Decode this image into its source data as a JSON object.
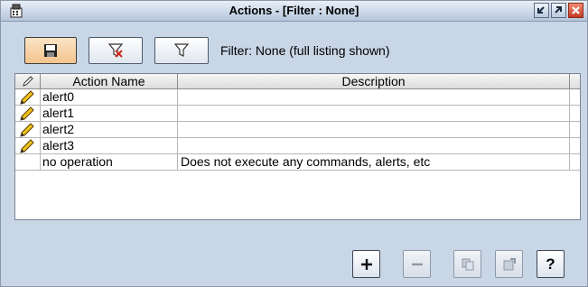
{
  "window": {
    "title": "Actions - [Filter : None]",
    "icons": [
      "app-icon",
      "minimize-icon",
      "maximize-icon",
      "close-icon"
    ]
  },
  "toolbar": {
    "buttons": [
      "save-icon",
      "clear-filter-icon",
      "filter-icon"
    ],
    "filter_status": "Filter: None (full listing shown)"
  },
  "table": {
    "columns": [
      "",
      "Action Name",
      "Description"
    ],
    "rows": [
      {
        "editable": true,
        "name": "alert0",
        "description": ""
      },
      {
        "editable": true,
        "name": "alert1",
        "description": ""
      },
      {
        "editable": true,
        "name": "alert2",
        "description": ""
      },
      {
        "editable": true,
        "name": "alert3",
        "description": ""
      },
      {
        "editable": false,
        "name": "no operation",
        "description": "Does not execute any commands, alerts, etc"
      }
    ]
  },
  "footer": {
    "buttons": [
      {
        "icon": "add-icon",
        "enabled": true
      },
      {
        "icon": "remove-icon",
        "enabled": false
      },
      {
        "icon": "copy-icon",
        "enabled": false
      },
      {
        "icon": "properties-icon",
        "enabled": false
      },
      {
        "icon": "help-icon",
        "enabled": true,
        "label": "?"
      }
    ]
  },
  "colors": {
    "window_bg": "#c9d6e6",
    "active_button": "#f4c48e",
    "close_button": "#d9472b"
  }
}
